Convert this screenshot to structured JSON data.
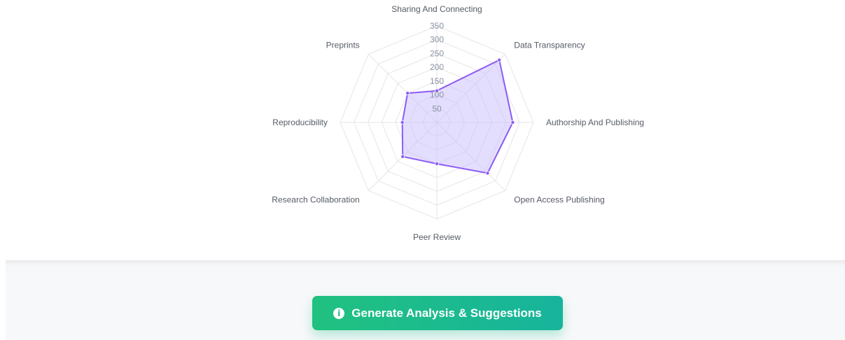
{
  "chart_data": {
    "type": "radar",
    "axes": [
      "Sharing And Connecting",
      "Data Transparency",
      "Authorship And Publishing",
      "Open Access Publishing",
      "Peer Review",
      "Research Collaboration",
      "Reproducibility",
      "Preprints"
    ],
    "series": [
      {
        "values": [
          115,
          320,
          275,
          260,
          150,
          175,
          125,
          150
        ]
      }
    ],
    "rlim": [
      0,
      350
    ],
    "ticks": [
      "50",
      "100",
      "150",
      "200",
      "250",
      "300",
      "350"
    ],
    "tick_values": [
      50,
      100,
      150,
      200,
      250,
      300,
      350
    ],
    "series_color": "#8b5cf6",
    "fill_color": "#c4b5fd",
    "grid_color": "#e6e6ea"
  },
  "actions": {
    "generate_label": "Generate Analysis & Suggestions",
    "icon": "info-circle-icon",
    "icon_glyph": "i"
  }
}
